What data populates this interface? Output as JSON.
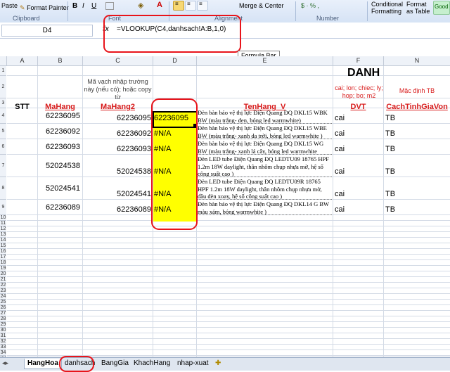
{
  "ribbon": {
    "paste": "Paste",
    "format_painter": "Format Painter",
    "clipboard": "Clipboard",
    "bold": "B",
    "italic": "I",
    "underline": "U",
    "font_group": "Font",
    "alignment_group": "Alignment",
    "merge_center": "Merge & Center",
    "number_group": "Number",
    "conditional_formatting": "Conditional",
    "conditional_formatting_2": "Formatting",
    "format_as_table": "Format",
    "format_as_table_2": "as Table",
    "good": "Good"
  },
  "formula_bar": {
    "name_box": "D4",
    "fx": "fx",
    "formula": "=VLOOKUP(C4,danhsach!A:B,1,0)",
    "tooltip": "Formula Bar"
  },
  "columns": [
    "A",
    "B",
    "C",
    "D",
    "E",
    "F",
    "N"
  ],
  "rows": [
    "1",
    "2",
    "3",
    "4",
    "5",
    "6",
    "7",
    "8",
    "9",
    "10",
    "11",
    "12",
    "13",
    "14",
    "15",
    "16",
    "17",
    "18",
    "19",
    "20",
    "21",
    "22",
    "23",
    "24",
    "25",
    "26",
    "27",
    "28",
    "29",
    "30",
    "31",
    "32",
    "33",
    "34",
    "35"
  ],
  "sheet": {
    "title_fragment": "DANH",
    "note_c": "Mã vạch nhập trường này (nếu có); hoặc copy từ",
    "note_f": "cai; lon; chiec; ly; hop; bo; m2",
    "note_n": "Mặc định TB",
    "headers": {
      "stt": "STT",
      "mahang": "MaHang",
      "mahang2": "MaHang2",
      "tenhang": "TenHang_V",
      "dvt": "DVT",
      "cach": "CachTinhGiaVon"
    },
    "data": [
      {
        "b": "62236095",
        "c": "62236095",
        "d": "62236095",
        "e": "Đèn bàn bảo vệ thị lực Điện Quang ĐQ DKL15 WBK BW (màu trắng- đen, bóng led warmwhite)",
        "f": "cai",
        "n": "TB"
      },
      {
        "b": "62236092",
        "c": "62236092",
        "d": "#N/A",
        "e": "Đèn bàn bảo vệ thị lực Điện Quang ĐQ DKL15 WBE BW (màu trắng- xanh da trời, bóng led warmwhite )",
        "f": "cai",
        "n": "TB"
      },
      {
        "b": "62236093",
        "c": "62236093",
        "d": "#N/A",
        "e": "Đèn bàn bảo vệ thị lực Điện Quang ĐQ DKL15 WG BW (màu trắng- xanh lá cây, bóng led warmwhite",
        "f": "cai",
        "n": "TB"
      },
      {
        "b": "52024538",
        "c": "52024538",
        "d": "#N/A",
        "e": "Đèn LED tube Điện Quang ĐQ LEDTU09 18765 HPF 1.2m 18W daylight, thân nhôm chụp nhựa mờ, hệ số công suất cao )",
        "f": "cai",
        "n": "TB"
      },
      {
        "b": "52024541",
        "c": "52024541",
        "d": "#N/A",
        "e": "Đèn LED tube Điện Quang ĐQ LEDTU09R 18765 HPF 1.2m 18W daylight, thân nhôm chụp nhựa mờ, đầu đèn xoay, hệ số công suất cao )",
        "f": "cai",
        "n": "TB"
      },
      {
        "b": "62236089",
        "c": "62236089",
        "d": "#N/A",
        "e": "Đèn bàn bảo vệ thị lực Điện Quang ĐQ DKL14 G BW màu xám, bóng warmwhite )",
        "f": "cai",
        "n": "TB"
      }
    ]
  },
  "tabs": [
    "HangHoa",
    "danhsach",
    "BangGia",
    "KhachHang",
    "nhap-xuat"
  ],
  "colors": {
    "highlight_red": "#e8141b",
    "yellow": "#ffff00",
    "header_red": "#d81b1b"
  }
}
